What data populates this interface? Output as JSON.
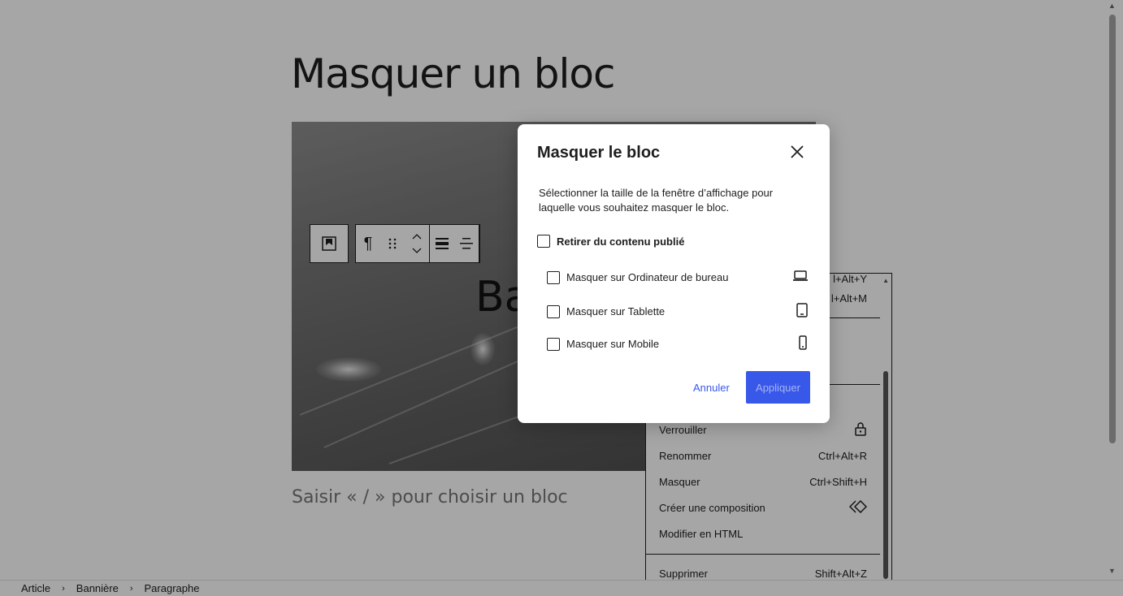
{
  "editor": {
    "post_title": "Masquer un bloc",
    "banner_text": "Ba",
    "appender_placeholder": "Saisir « / » pour choisir un bloc"
  },
  "toolbar": {
    "items": [
      "bookmark-icon",
      "paragraph-icon",
      "drag-handle-icon",
      "move-up-down-icon",
      "align-full-icon",
      "align-center-icon"
    ]
  },
  "dropdown": {
    "partial_top_shortcut_1": "l+Alt+Y",
    "partial_top_shortcut_2": "l+Alt+M",
    "items": [
      {
        "label": "Verrouiller",
        "icon": "lock-icon"
      },
      {
        "label": "Renommer",
        "shortcut": "Ctrl+Alt+R"
      },
      {
        "label": "Masquer",
        "shortcut": "Ctrl+Shift+H"
      },
      {
        "label": "Créer une composition",
        "icon": "pattern-icon"
      },
      {
        "label": "Modifier en HTML"
      },
      {
        "label": "Supprimer",
        "shortcut": "Shift+Alt+Z"
      }
    ]
  },
  "breadcrumb": [
    "Article",
    "Bannière",
    "Paragraphe"
  ],
  "modal": {
    "title": "Masquer le bloc",
    "description": "Sélectionner la taille de la fenêtre d’affichage pour laquelle vous souhaitez masquer le bloc.",
    "remove_label": "Retirer du contenu publié",
    "devices": [
      {
        "label": "Masquer sur Ordinateur de bureau",
        "icon": "desktop-icon",
        "checked": false
      },
      {
        "label": "Masquer sur Tablette",
        "icon": "tablet-icon",
        "checked": false
      },
      {
        "label": "Masquer sur Mobile",
        "icon": "mobile-icon",
        "checked": false
      }
    ],
    "cancel_label": "Annuler",
    "apply_label": "Appliquer",
    "accent_color": "#3858e9"
  }
}
